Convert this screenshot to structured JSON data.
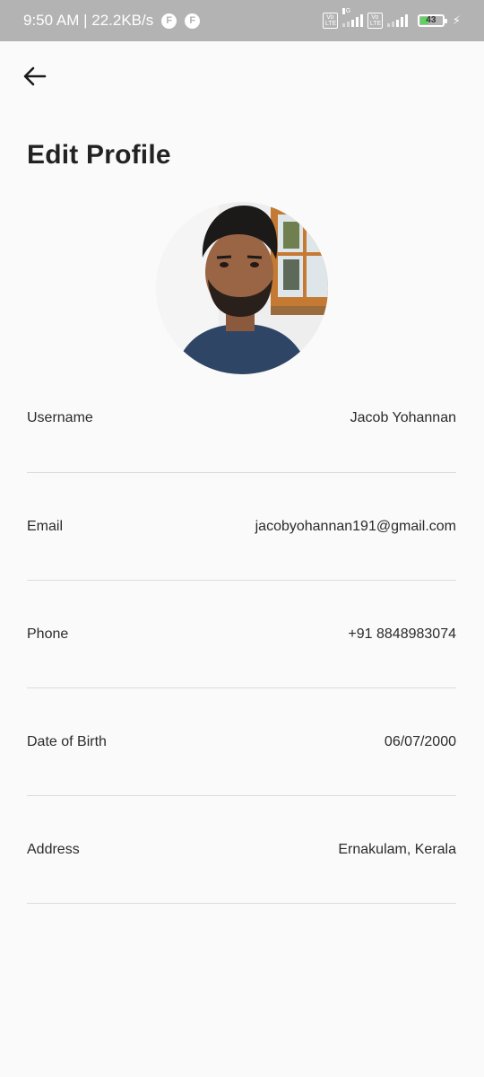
{
  "status_bar": {
    "time_speed": "9:50 AM | 22.2KB/s",
    "app_icon_1": "F",
    "app_icon_2": "F",
    "volte_1": "Vo LTE",
    "volte_2": "Vo LTE",
    "network_type": "4G",
    "battery_level": "43",
    "icons": [
      "volte-icon",
      "signal-icon",
      "battery-icon",
      "charging-icon"
    ]
  },
  "header": {
    "back_icon": "back-arrow-icon",
    "title": "Edit Profile"
  },
  "profile": {
    "avatar": "profile-photo"
  },
  "fields": [
    {
      "label": "Username",
      "value": "Jacob Yohannan"
    },
    {
      "label": "Email",
      "value": "jacobyohannan191@gmail.com"
    },
    {
      "label": "Phone",
      "value": "+91 8848983074"
    },
    {
      "label": "Date of Birth",
      "value": "06/07/2000"
    },
    {
      "label": "Address",
      "value": "Ernakulam, Kerala"
    }
  ],
  "colors": {
    "background": "#fafafa",
    "status_bar": "#b3b3b3",
    "text": "#222222",
    "divider": "#dcdcdc",
    "battery": "#5ed35e"
  }
}
